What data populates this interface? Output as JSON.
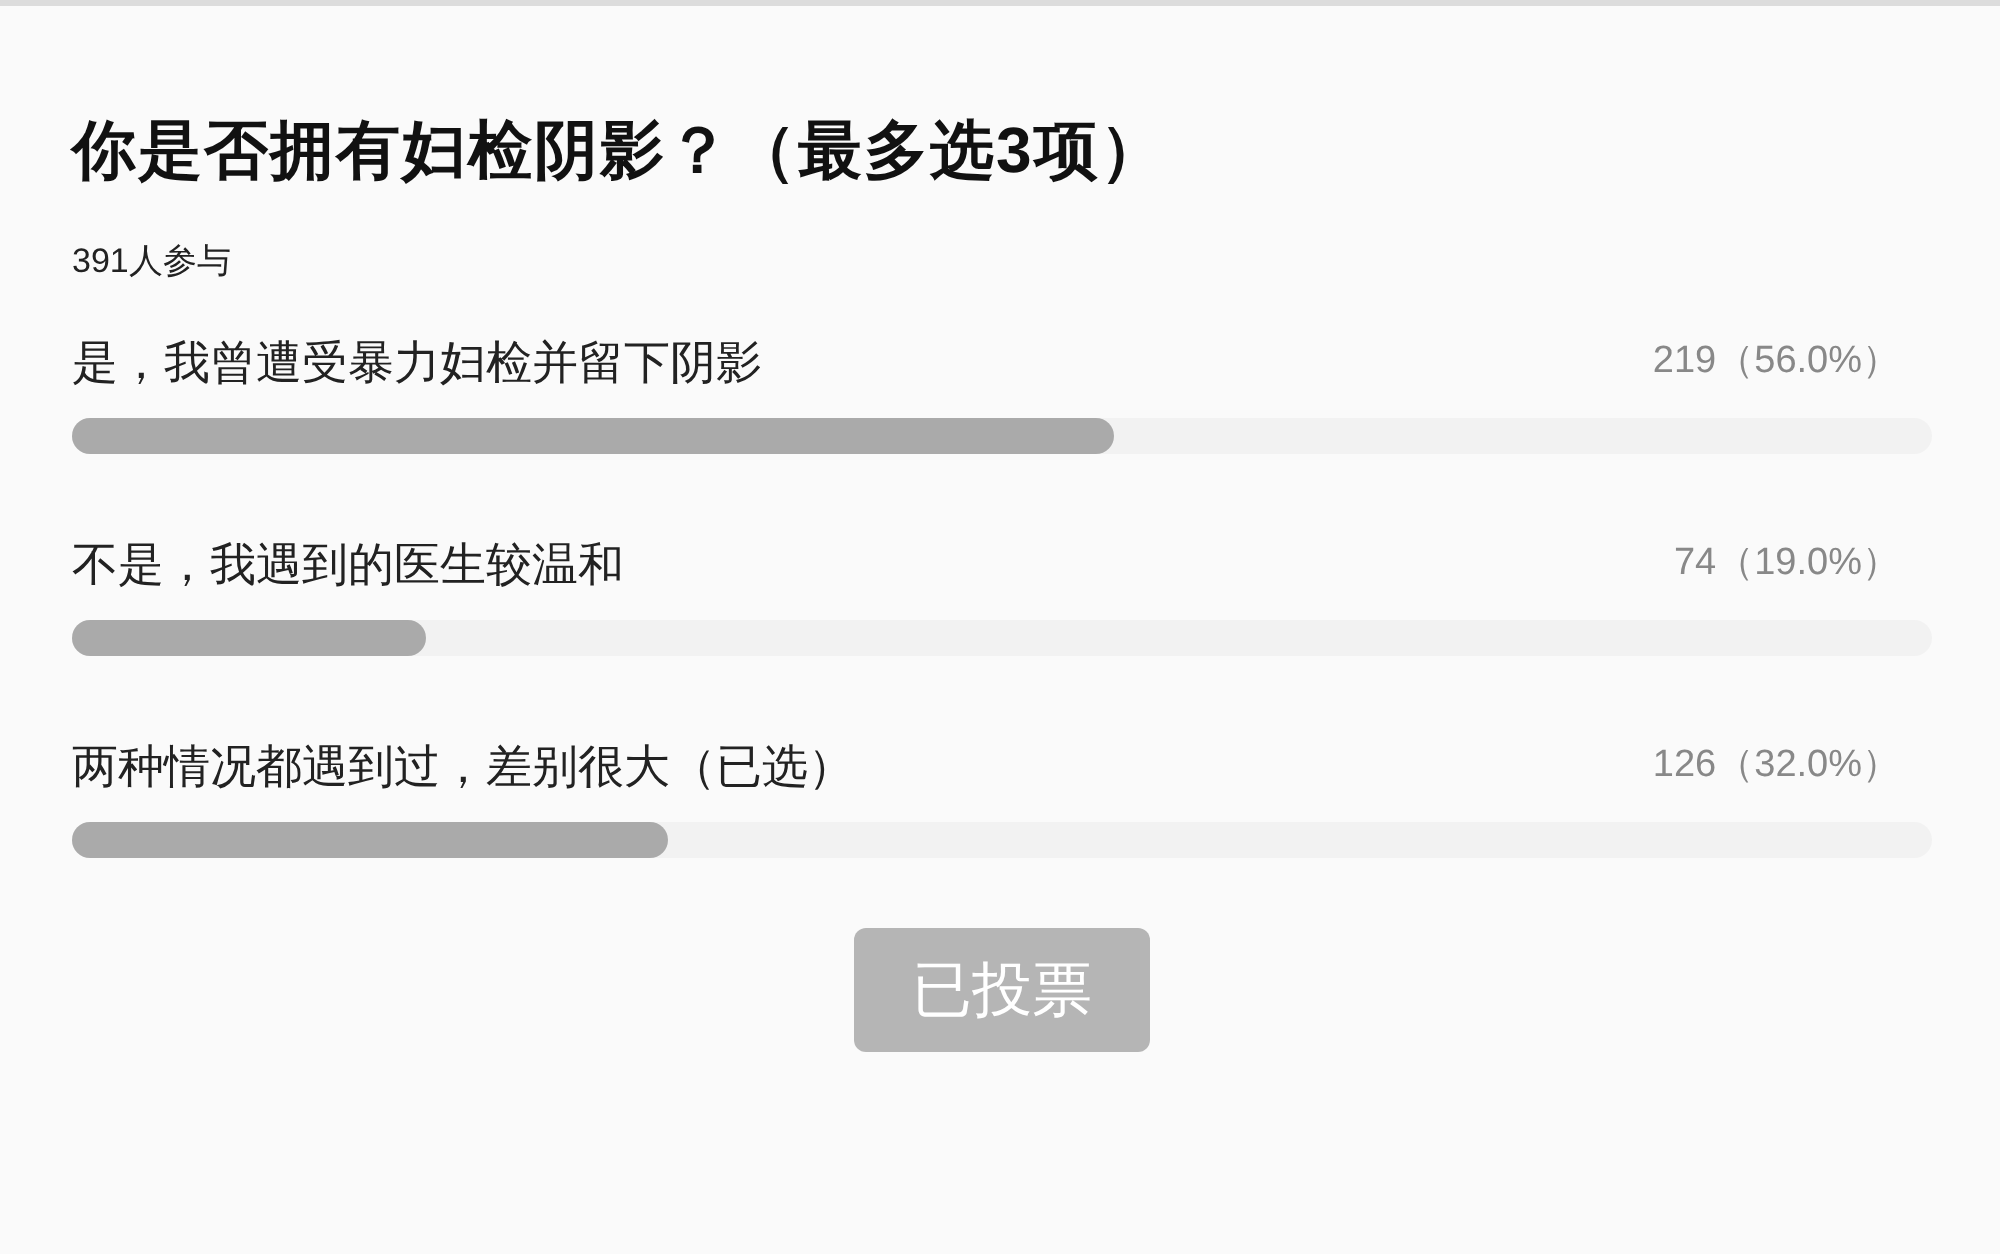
{
  "poll": {
    "title": "你是否拥有妇检阴影？（最多选3项）",
    "participants": "391人参与",
    "options": [
      {
        "label": "是，我曾遭受暴力妇检并留下阴影",
        "result": "219（56.0%）",
        "level": 0.56
      },
      {
        "label": "不是，我遇到的医生较温和",
        "result": "74（19.0%）",
        "level": 0.19
      },
      {
        "label": "两种情况都遇到过，差别很大（已选）",
        "result": "126（32.0%）",
        "level": 0.32
      }
    ],
    "button": {
      "label": "已投票",
      "disabled": true
    }
  }
}
